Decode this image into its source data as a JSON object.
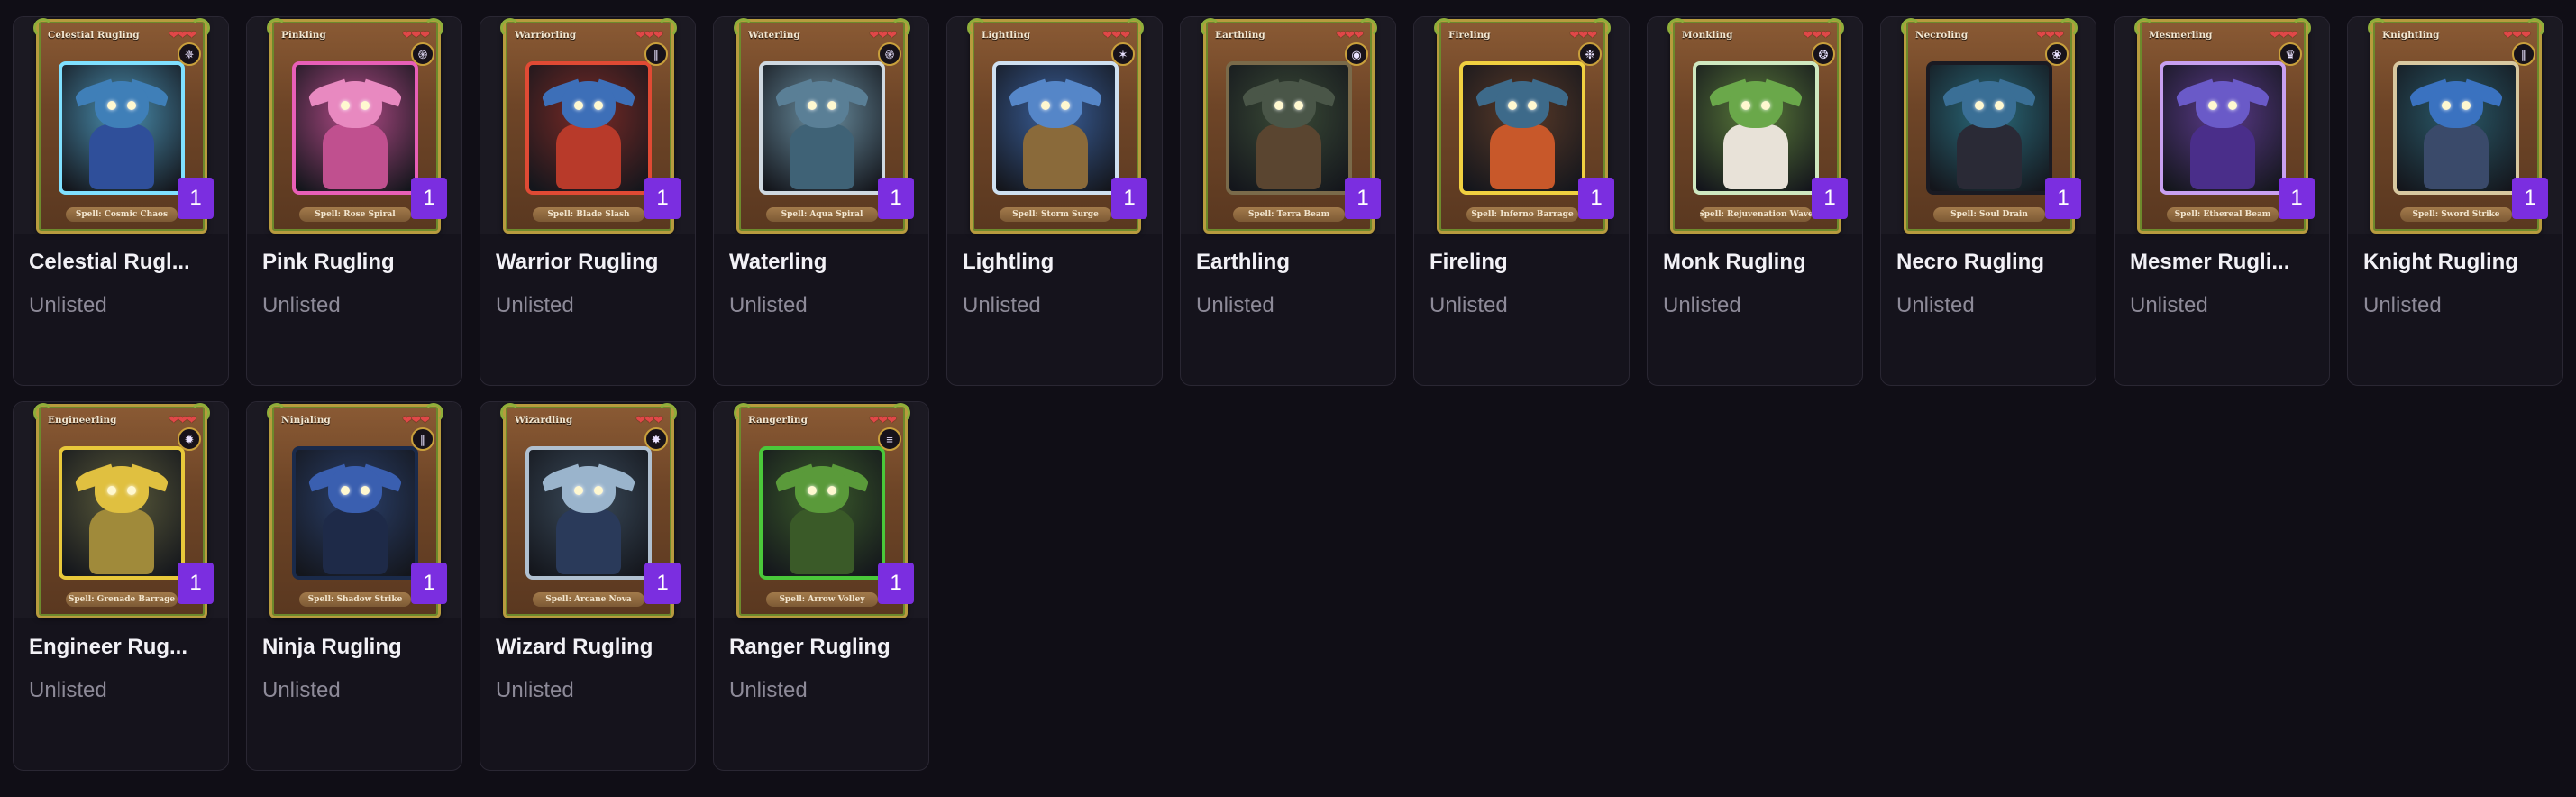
{
  "cards": [
    {
      "title": "Celestial Rugl...",
      "status": "Unlisted",
      "card_name": "Celestial Rugling",
      "spell": "Spell: Cosmic Chaos",
      "qty": "1",
      "icon": "cosmic-swirl-icon",
      "glyph": "✵",
      "frame": "#7fe0ff",
      "bg": "#4a8fb0",
      "skin": "#3f7fb8",
      "robe": "#2f4f9a"
    },
    {
      "title": "Pink Rugling",
      "status": "Unlisted",
      "card_name": "Pinkling",
      "spell": "Spell: Rose Spiral",
      "qty": "1",
      "icon": "spiral-icon",
      "glyph": "֍",
      "frame": "#e85fb7",
      "bg": "#b04a86",
      "skin": "#e889c0",
      "robe": "#c0508f"
    },
    {
      "title": "Warrior Rugling",
      "status": "Unlisted",
      "card_name": "Warriorling",
      "spell": "Spell: Blade Slash",
      "qty": "1",
      "icon": "claw-slash-icon",
      "glyph": "∥",
      "frame": "#e04a34",
      "bg": "#7a2a26",
      "skin": "#3d6fb8",
      "robe": "#b83a2a"
    },
    {
      "title": "Waterling",
      "status": "Unlisted",
      "card_name": "Waterling",
      "spell": "Spell: Aqua Spiral",
      "qty": "1",
      "icon": "water-swirl-icon",
      "glyph": "֎",
      "frame": "#cfd8e0",
      "bg": "#6a8ea0",
      "skin": "#5a7f96",
      "robe": "#3f6276"
    },
    {
      "title": "Lightling",
      "status": "Unlisted",
      "card_name": "Lightling",
      "spell": "Spell: Storm Surge",
      "qty": "1",
      "icon": "storm-icon",
      "glyph": "✶",
      "frame": "#cfe0f0",
      "bg": "#3a5f9a",
      "skin": "#5586c8",
      "robe": "#8a6a3a"
    },
    {
      "title": "Earthling",
      "status": "Unlisted",
      "card_name": "Earthling",
      "spell": "Spell: Terra Beam",
      "qty": "1",
      "icon": "earth-orb-icon",
      "glyph": "◉",
      "frame": "#7a6a4a",
      "bg": "#3a4a36",
      "skin": "#4a5648",
      "robe": "#5a4530"
    },
    {
      "title": "Fireling",
      "status": "Unlisted",
      "card_name": "Fireling",
      "spell": "Spell: Inferno Barrage",
      "qty": "1",
      "icon": "flame-icon",
      "glyph": "❉",
      "frame": "#f0d040",
      "bg": "#5a3a28",
      "skin": "#3d6a8a",
      "robe": "#c8582a"
    },
    {
      "title": "Monk Rugling",
      "status": "Unlisted",
      "card_name": "Monkling",
      "spell": "Spell: Rejuvenation Wave",
      "qty": "1",
      "icon": "healing-orb-icon",
      "glyph": "❂",
      "frame": "#cfe8c0",
      "bg": "#5a7a3a",
      "skin": "#6aa84a",
      "robe": "#e8e2d8"
    },
    {
      "title": "Necro Rugling",
      "status": "Unlisted",
      "card_name": "Necroling",
      "spell": "Spell: Soul Drain",
      "qty": "1",
      "icon": "soul-orb-icon",
      "glyph": "❀",
      "frame": "#1a1a22",
      "bg": "#2a6a7a",
      "skin": "#3a6f96",
      "robe": "#2a2a36"
    },
    {
      "title": "Mesmer Rugli...",
      "status": "Unlisted",
      "card_name": "Mesmerling",
      "spell": "Spell: Ethereal Beam",
      "qty": "1",
      "icon": "ethereal-crown-icon",
      "glyph": "♛",
      "frame": "#c8a0f0",
      "bg": "#5a3a8a",
      "skin": "#6a5ac8",
      "robe": "#4a2e8a"
    },
    {
      "title": "Knight Rugling",
      "status": "Unlisted",
      "card_name": "Knightling",
      "spell": "Spell: Sword Strike",
      "qty": "1",
      "icon": "sword-slash-icon",
      "glyph": "∥",
      "frame": "#d8c8a0",
      "bg": "#2a5a6a",
      "skin": "#3a72c0",
      "robe": "#3a4a6a"
    },
    {
      "title": "Engineer Rug...",
      "status": "Unlisted",
      "card_name": "Engineerling",
      "spell": "Spell: Grenade Barrage",
      "qty": "1",
      "icon": "explosion-icon",
      "glyph": "✹",
      "frame": "#e8c83a",
      "bg": "#5a5a3a",
      "skin": "#e0c040",
      "robe": "#a08a3a"
    },
    {
      "title": "Ninja Rugling",
      "status": "Unlisted",
      "card_name": "Ninjaling",
      "spell": "Spell: Shadow Strike",
      "qty": "1",
      "icon": "shadow-slash-icon",
      "glyph": "∥",
      "frame": "#1a2a4a",
      "bg": "#2a3f6a",
      "skin": "#3a5fb0",
      "robe": "#1e2a48"
    },
    {
      "title": "Wizard Rugling",
      "status": "Unlisted",
      "card_name": "Wizardling",
      "spell": "Spell: Arcane Nova",
      "qty": "1",
      "icon": "arcane-nova-icon",
      "glyph": "✸",
      "frame": "#b0c0d0",
      "bg": "#3a4a5a",
      "skin": "#9ab4cc",
      "robe": "#2a3a5a"
    },
    {
      "title": "Ranger Rugling",
      "status": "Unlisted",
      "card_name": "Rangerling",
      "spell": "Spell: Arrow Volley",
      "qty": "1",
      "icon": "arrow-volley-icon",
      "glyph": "≡",
      "frame": "#4ac83a",
      "bg": "#3a5a2a",
      "skin": "#5a9a3a",
      "robe": "#3a5a28"
    }
  ]
}
